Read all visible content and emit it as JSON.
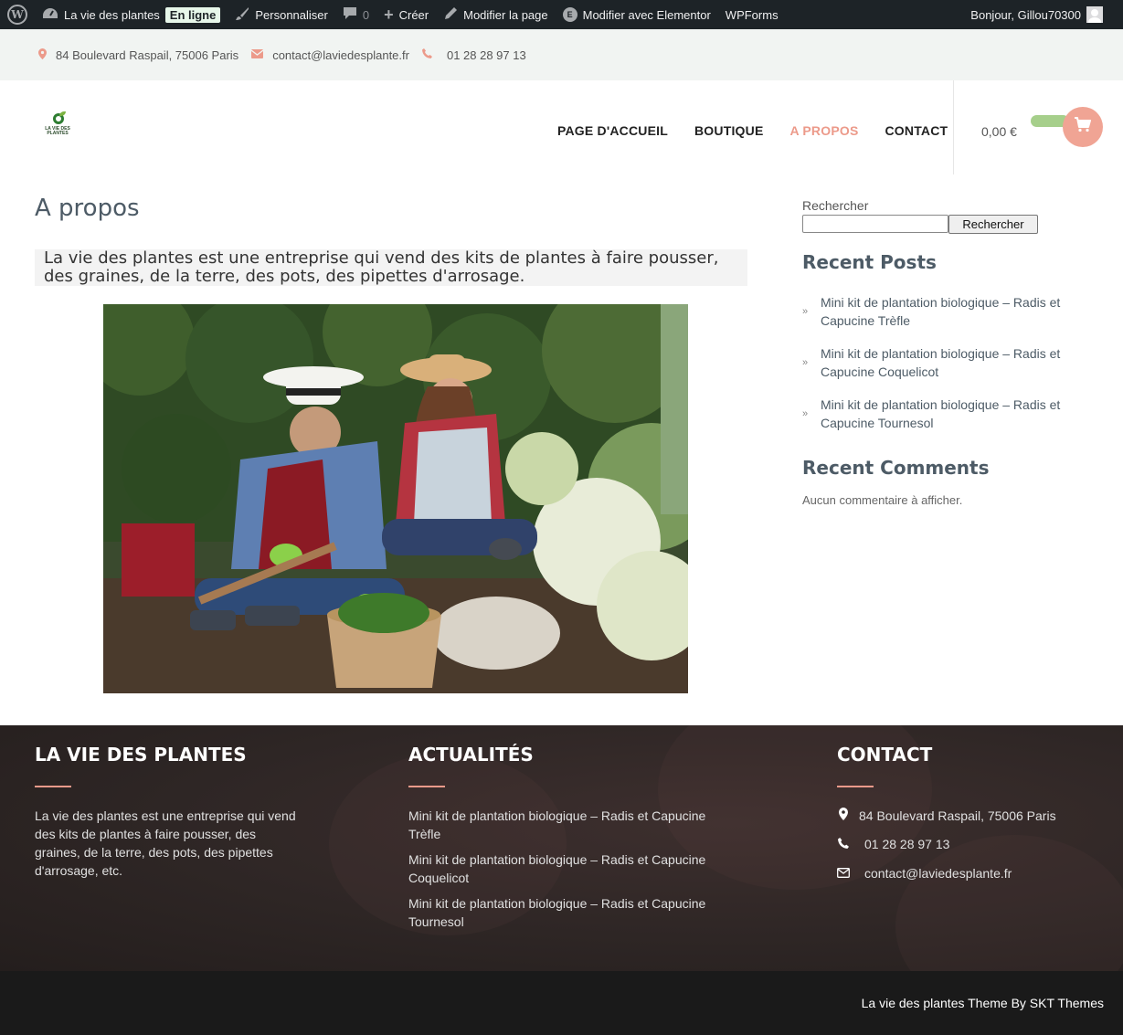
{
  "adminbar": {
    "site_name": "La vie des plantes",
    "status_badge": "En ligne",
    "customize": "Personnaliser",
    "comments_count": "0",
    "create": "Créer",
    "edit_page": "Modifier la page",
    "edit_elementor": "Modifier avec Elementor",
    "wpforms": "WPForms",
    "greeting": "Bonjour, Gillou70300"
  },
  "topbar": {
    "address": "84 Boulevard Raspail, 75006 Paris",
    "email": "contact@laviedesplante.fr",
    "phone": "01 28 28 97 13"
  },
  "header": {
    "logo_text": "LA VIE DES PLANTES",
    "nav": [
      {
        "label": "PAGE D'ACCUEIL"
      },
      {
        "label": "BOUTIQUE"
      },
      {
        "label": "A PROPOS"
      },
      {
        "label": "CONTACT"
      }
    ],
    "active_nav": "A PROPOS",
    "cart_amount": "0,00 €"
  },
  "main": {
    "title": "A propos",
    "intro": "La vie des plantes est une entreprise qui vend des kits de plantes à faire pousser, des graines, de la terre, des pots, des pipettes d'arrosage."
  },
  "sidebar": {
    "search_label": "Rechercher",
    "search_button": "Rechercher",
    "recent_posts_title": "Recent Posts",
    "recent_posts": [
      {
        "line1": "Mini kit de plantation biologique – Radis et",
        "line2": "Capucine Trèfle"
      },
      {
        "line1": "Mini kit de plantation biologique – Radis et",
        "line2": "Capucine Coquelicot"
      },
      {
        "line1": "Mini kit de plantation biologique – Radis et",
        "line2": "Capucine Tournesol"
      }
    ],
    "recent_comments_title": "Recent Comments",
    "no_comments": "Aucun commentaire à afficher."
  },
  "footer": {
    "col1_title": "LA VIE DES PLANTES",
    "col1_text": [
      "La vie des plantes est une entreprise qui vend",
      "des kits de plantes à faire pousser, des",
      "graines, de la terre, des pots, des pipettes",
      "d'arrosage, etc."
    ],
    "col2_title": "ACTUALITÉS",
    "col2_links": [
      {
        "line1": "Mini kit de plantation biologique – Radis et Capucine",
        "line2": "Trèfle"
      },
      {
        "line1": "Mini kit de plantation biologique – Radis et Capucine",
        "line2": "Coquelicot"
      },
      {
        "line1": "Mini kit de plantation biologique – Radis et Capucine",
        "line2": "Tournesol"
      }
    ],
    "col3_title": "CONTACT",
    "contact_address": "84 Boulevard Raspail, 75006 Paris",
    "contact_phone": "01 28 28 97 13",
    "contact_email": "contact@laviedesplante.fr",
    "copyright": "La vie des plantes Theme By SKT Themes"
  },
  "colors": {
    "accent": "#ec9a8a",
    "cart_pill": "#a6cf8b",
    "admin_bg": "#1d2327",
    "footer_bg": "#2e2625"
  }
}
